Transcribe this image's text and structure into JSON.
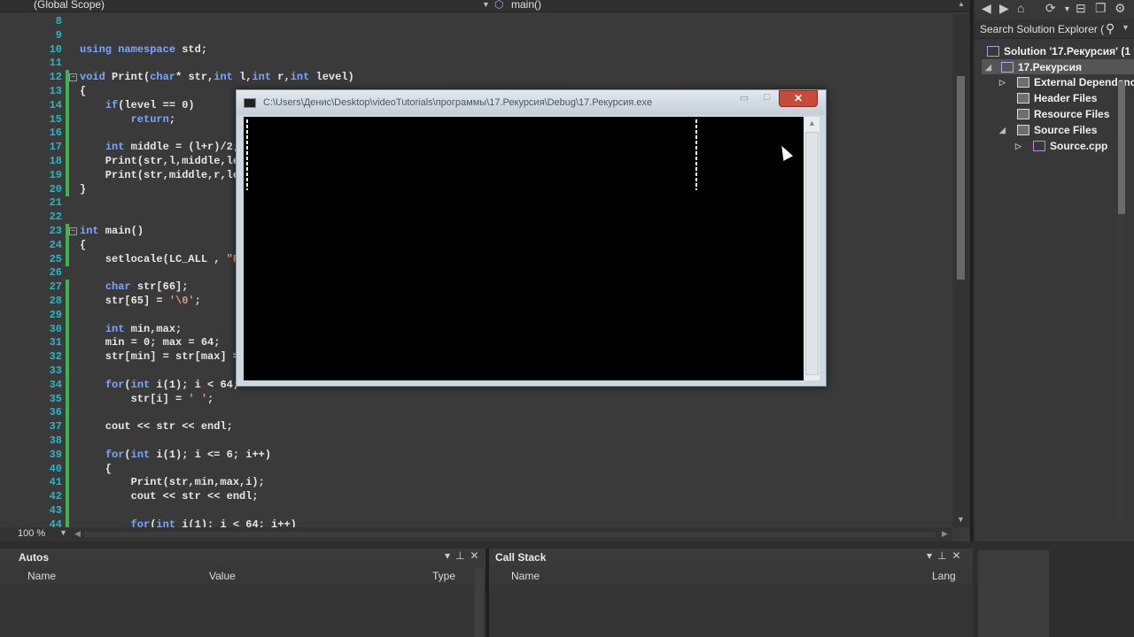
{
  "navbar": {
    "scope_left": "(Global Scope)",
    "scope_right": "main()",
    "scope_right_icon": "function-icon"
  },
  "code": {
    "lines": [
      {
        "num": "8",
        "text": ""
      },
      {
        "num": "9",
        "text": ""
      },
      {
        "num": "10",
        "text": "using namespace std;"
      },
      {
        "num": "11",
        "text": ""
      },
      {
        "num": "12",
        "text": "void Print(char* str,int l,int r,int level)"
      },
      {
        "num": "13",
        "text": "{"
      },
      {
        "num": "14",
        "text": "    if(level == 0)"
      },
      {
        "num": "15",
        "text": "        return;"
      },
      {
        "num": "16",
        "text": ""
      },
      {
        "num": "17",
        "text": "    int middle = (l+r)/2;"
      },
      {
        "num": "18",
        "text": "    Print(str,l,middle,le"
      },
      {
        "num": "19",
        "text": "    Print(str,middle,r,le"
      },
      {
        "num": "20",
        "text": "}"
      },
      {
        "num": "21",
        "text": ""
      },
      {
        "num": "22",
        "text": ""
      },
      {
        "num": "23",
        "text": "int main()"
      },
      {
        "num": "24",
        "text": "{"
      },
      {
        "num": "25",
        "text": "    setlocale(LC_ALL , \"R"
      },
      {
        "num": "26",
        "text": ""
      },
      {
        "num": "27",
        "text": "    char str[66];"
      },
      {
        "num": "28",
        "text": "    str[65] = '\\0';"
      },
      {
        "num": "29",
        "text": ""
      },
      {
        "num": "30",
        "text": "    int min,max;"
      },
      {
        "num": "31",
        "text": "    min = 0; max = 64;"
      },
      {
        "num": "32",
        "text": "    str[min] = str[max] ="
      },
      {
        "num": "33",
        "text": ""
      },
      {
        "num": "34",
        "text": "    for(int i(1); i < 64;"
      },
      {
        "num": "35",
        "text": "        str[i] = ' ';"
      },
      {
        "num": "36",
        "text": ""
      },
      {
        "num": "37",
        "text": "    cout << str << endl;"
      },
      {
        "num": "38",
        "text": ""
      },
      {
        "num": "39",
        "text": "    for(int i(1); i <= 6; i++)"
      },
      {
        "num": "40",
        "text": "    {"
      },
      {
        "num": "41",
        "text": "        Print(str,min,max,i);"
      },
      {
        "num": "42",
        "text": "        cout << str << endl;"
      },
      {
        "num": "43",
        "text": ""
      },
      {
        "num": "44",
        "text": "        for(int i(1); i < 64; i++)"
      }
    ]
  },
  "zoom": {
    "label": "100 %"
  },
  "solution_explorer": {
    "search_placeholder": "Search Solution Explorer (",
    "items": [
      {
        "label": "Solution '17.Рекурсия' (1 p",
        "icon": "solution-icon",
        "level": 0
      },
      {
        "label": "17.Рекурсия",
        "icon": "project-icon",
        "level": 1,
        "selected": true
      },
      {
        "label": "External Dependenc",
        "icon": "folder-icon",
        "level": 2
      },
      {
        "label": "Header Files",
        "icon": "folder-icon",
        "level": 2
      },
      {
        "label": "Resource Files",
        "icon": "folder-icon",
        "level": 2
      },
      {
        "label": "Source Files",
        "icon": "folder-icon",
        "level": 2
      },
      {
        "label": "Source.cpp",
        "icon": "cpp-file-icon",
        "level": 3
      }
    ]
  },
  "autos_panel": {
    "title": "Autos",
    "columns": [
      "Name",
      "Value",
      "Type"
    ]
  },
  "callstack_panel": {
    "title": "Call Stack",
    "columns": [
      "Name",
      "Lang"
    ]
  },
  "console": {
    "title": "C:\\Users\\Денис\\Desktop\\videoTutorials\\программы\\17.Рекурсия\\Debug\\17.Рекурсия.exe",
    "minimize": "▭",
    "maximize": "□",
    "close": "✕"
  }
}
